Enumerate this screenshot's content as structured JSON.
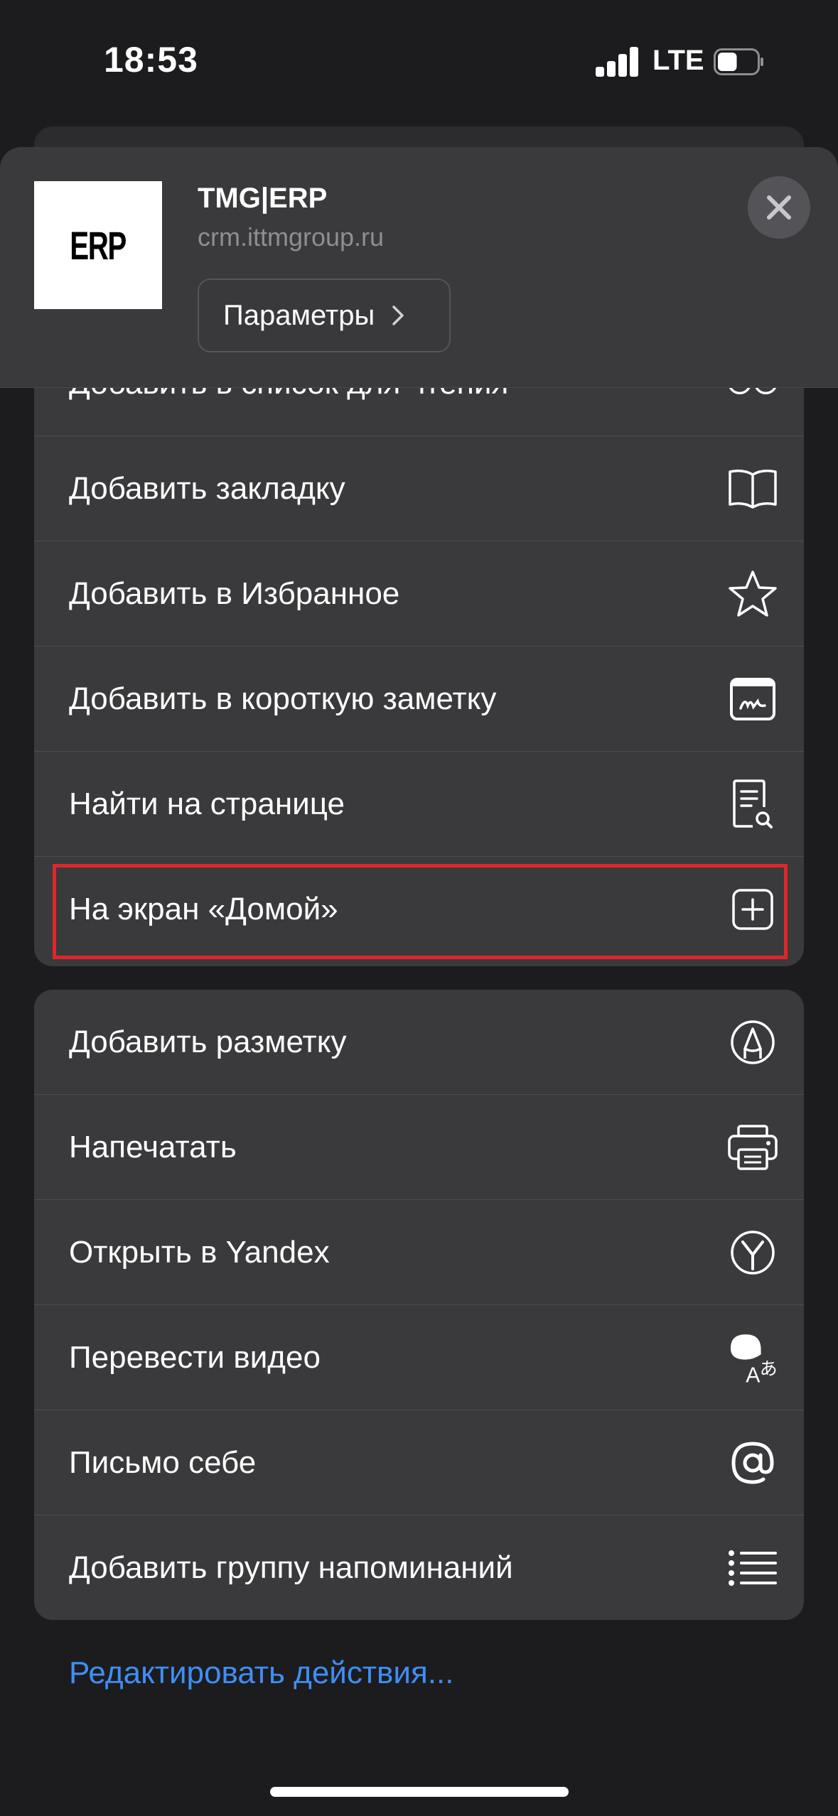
{
  "status_bar": {
    "time": "18:53",
    "network": "LTE",
    "signal_icon": "cellular-signal-icon",
    "battery_icon": "battery-icon",
    "battery_level": 0.5
  },
  "header": {
    "app_icon_text": "ERP",
    "title": "TMG|ERP",
    "url": "crm.ittmgroup.ru",
    "params_label": "Параметры",
    "close_icon": "close-icon"
  },
  "group1": {
    "items": [
      {
        "label": "Добавить в список для чтения",
        "icon": "glasses-icon"
      },
      {
        "label": "Добавить закладку",
        "icon": "book-icon"
      },
      {
        "label": "Добавить в Избранное",
        "icon": "star-icon"
      },
      {
        "label": "Добавить в короткую заметку",
        "icon": "quick-note-icon"
      },
      {
        "label": "Найти на странице",
        "icon": "find-on-page-icon"
      },
      {
        "label": "На экран «Домой»",
        "icon": "add-square-icon"
      }
    ]
  },
  "group2": {
    "items": [
      {
        "label": "Добавить разметку",
        "icon": "markup-pen-icon"
      },
      {
        "label": "Напечатать",
        "icon": "printer-icon"
      },
      {
        "label": "Открыть в Yandex",
        "icon": "yandex-icon"
      },
      {
        "label": "Перевести видео",
        "icon": "translate-icon"
      },
      {
        "label": "Письмо себе",
        "icon": "at-sign-icon"
      },
      {
        "label": "Добавить группу напоминаний",
        "icon": "list-icon"
      }
    ]
  },
  "edit_actions": "Редактировать действия...",
  "colors": {
    "background": "#1c1c1e",
    "card": "#3a3a3c",
    "link": "#3f8ef5",
    "highlight": "#e0262b"
  }
}
